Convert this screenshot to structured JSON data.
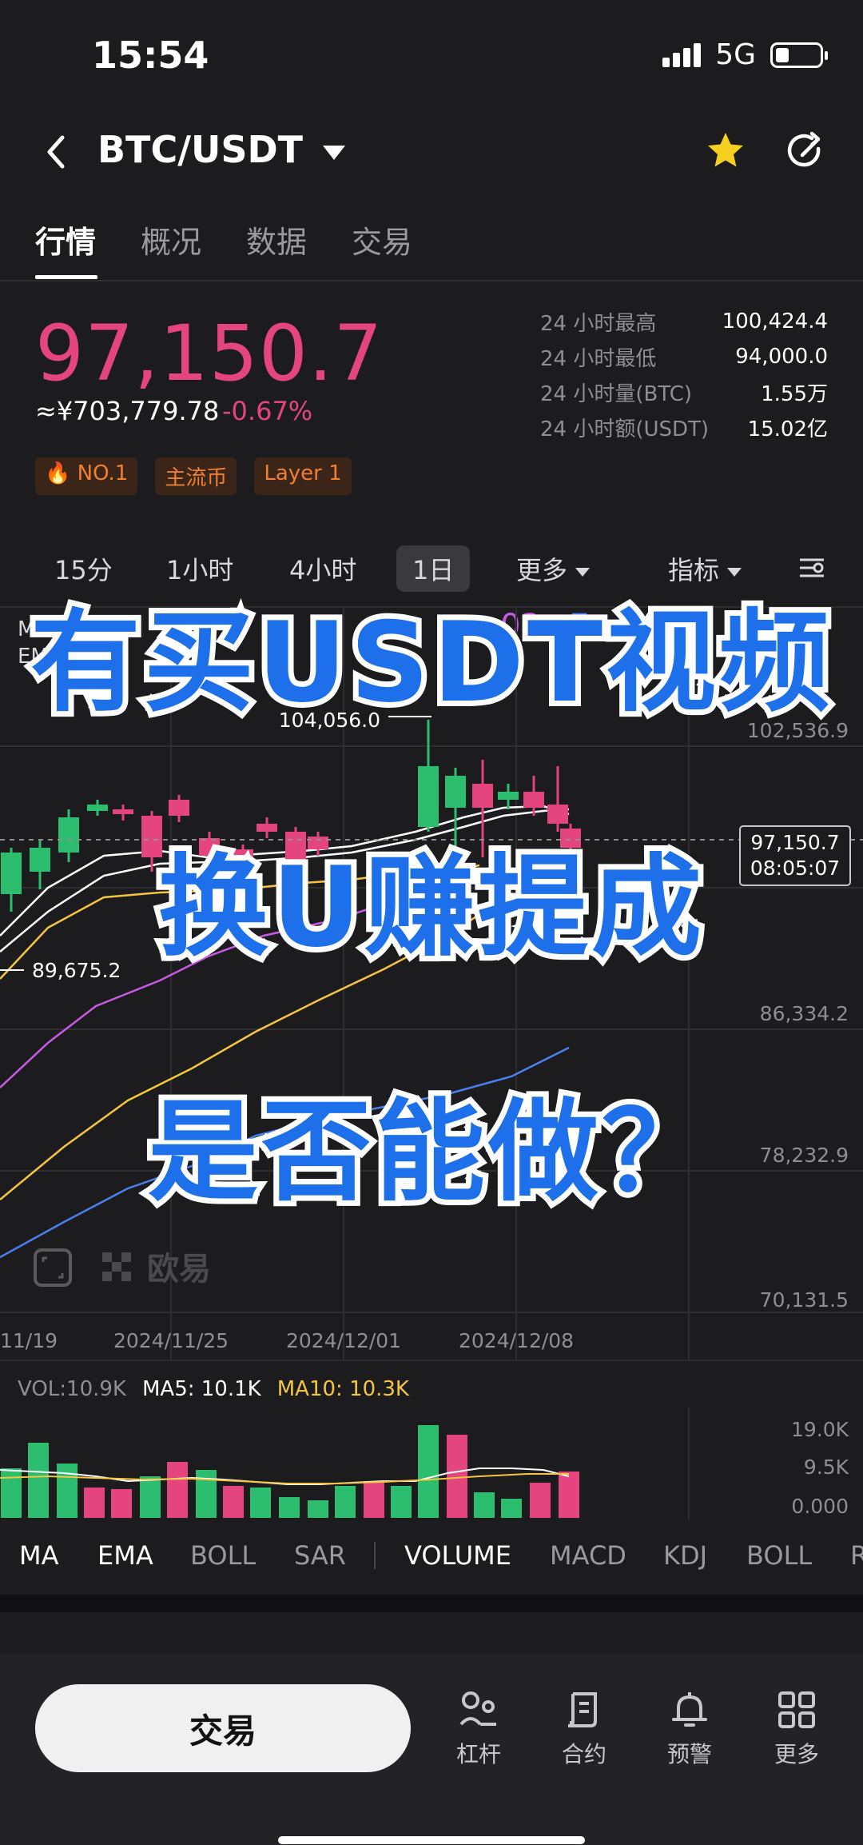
{
  "status_bar": {
    "time": "15:54",
    "network": "5G"
  },
  "header": {
    "pair": "BTC/USDT"
  },
  "tabs": [
    "行情",
    "概况",
    "数据",
    "交易"
  ],
  "price": {
    "last": "97,150.7",
    "cny": "≈¥703,779.78",
    "change": "-0.67%"
  },
  "stats": [
    {
      "label": "24 小时最高",
      "value": "100,424.4"
    },
    {
      "label": "24 小时最低",
      "value": "94,000.0"
    },
    {
      "label": "24 小时量(BTC)",
      "value": "1.55万"
    },
    {
      "label": "24 小时额(USDT)",
      "value": "15.02亿"
    }
  ],
  "tags": [
    "NO.1",
    "主流币",
    "Layer 1"
  ],
  "intervals": [
    "15分",
    "1小时",
    "4小时",
    "1日",
    "更多",
    "指标"
  ],
  "chart": {
    "ma_label": "MA",
    "ema_label": "EMA",
    "ma_fragment": "03",
    "ema_fragment": "E",
    "high_marker": "104,056.0",
    "low_marker": "89,675.2",
    "current_price_tag": "97,150.7",
    "countdown": "08:05:07",
    "y_axis_labels": [
      "102,536.9",
      "86,334.2",
      "78,232.9",
      "70,131.5"
    ],
    "x_axis_labels": [
      "11/19",
      "2024/11/25",
      "2024/12/01",
      "2024/12/08"
    ],
    "watermark": "欧易"
  },
  "volume": {
    "vol": "VOL:10.9K",
    "ma5": "MA5: 10.1K",
    "ma10": "MA10: 10.3K",
    "y_axis_labels": [
      "19.0K",
      "9.5K",
      "0.000"
    ]
  },
  "indicators": [
    "MA",
    "EMA",
    "BOLL",
    "SAR",
    "VOLUME",
    "MACD",
    "KDJ",
    "BOLL",
    "R"
  ],
  "overlay": {
    "line1": "有买USDT视频",
    "line2": "换U赚提成",
    "line3": "是否能做？"
  },
  "bottom_nav": {
    "trade": "交易",
    "items": [
      "杠杆",
      "合约",
      "预警",
      "更多"
    ]
  },
  "colors": {
    "up": "#2dbd6e",
    "down": "#e4457f",
    "ma_yellow": "#f5c542",
    "ma_purple": "#c85ae6",
    "ma_blue": "#4a7ff0",
    "overlay_text": "#1d70ea"
  },
  "chart_data": {
    "type": "candlestick",
    "x": [
      "11/19",
      "2024/11/25",
      "2024/12/01",
      "2024/12/08"
    ],
    "y_range": [
      70131.5,
      102536.9
    ],
    "last_price": 97150.7,
    "period_high": 104056.0,
    "period_low": 89675.2,
    "volume_range": [
      0,
      19000
    ]
  }
}
